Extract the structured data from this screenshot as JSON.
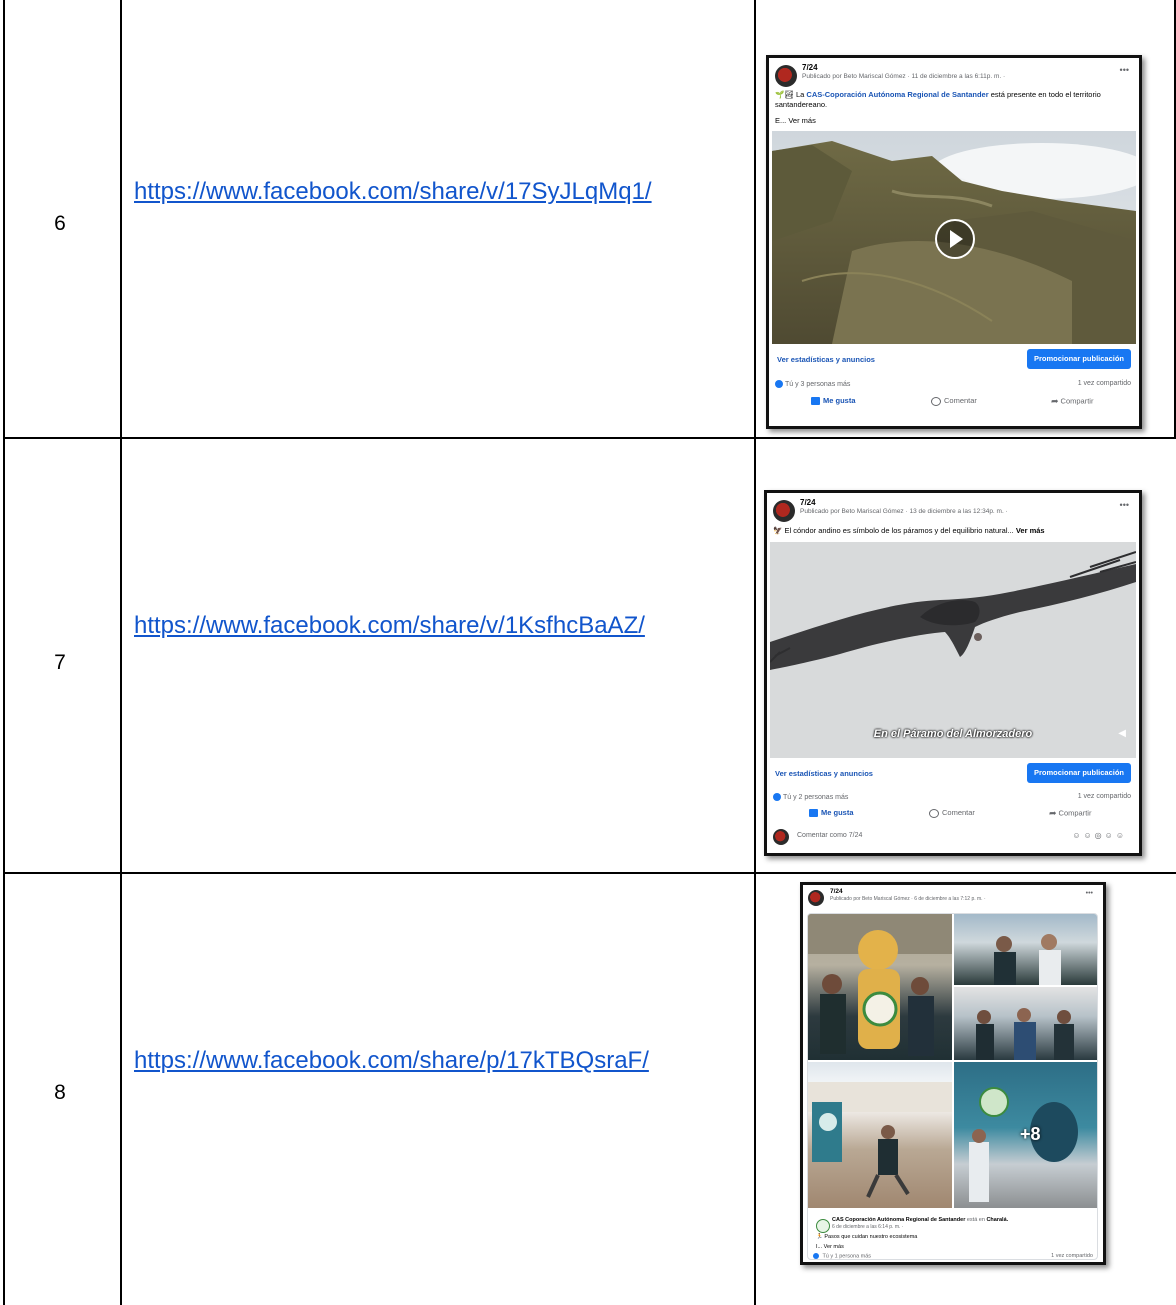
{
  "rows": [
    {
      "number": "6",
      "link": "https://www.facebook.com/share/v/17SyJLqMq1/",
      "post": {
        "page_name": "7/24",
        "meta": "Publicado por Beto Mariscal Gómez · 11 de diciembre a las 6:11p. m. ·",
        "text_prefix": "La",
        "text_link": "CAS-Coporación Autónoma Regional de Santander",
        "text_suffix": "está presente en todo el territorio santandereano.",
        "see_more": "E... Ver más",
        "stats_link": "Ver estadísticas y anuncios",
        "promote": "Promocionar publicación",
        "reactions": "Tú y 3 personas más",
        "shares": "1 vez compartido",
        "like": "Me gusta",
        "comment": "Comentar",
        "share": "Compartir"
      }
    },
    {
      "number": "7",
      "link": "https://www.facebook.com/share/v/1KsfhcBaAZ/",
      "post": {
        "page_name": "7/24",
        "meta": "Publicado por Beto Mariscal Gómez · 13 de diciembre a las 12:34p. m. ·",
        "text": "El cóndor andino es símbolo de los páramos y del equilibrio natural...",
        "see_more": "Ver más",
        "caption": "En el Páramo del Almorzadero",
        "stats_link": "Ver estadísticas y anuncios",
        "promote": "Promocionar publicación",
        "reactions": "Tú y 2 personas más",
        "shares": "1 vez compartido",
        "like": "Me gusta",
        "comment": "Comentar",
        "share": "Compartir",
        "comment_placeholder": "Comentar como 7/24"
      }
    },
    {
      "number": "8",
      "link": "https://www.facebook.com/share/p/17kTBQsraF/",
      "post": {
        "page_name": "7/24",
        "meta": "Publicado por Beto Mariscal Gómez · 6 de diciembre a las 7:12 p. m. ·",
        "more_photos": "+8",
        "shared_page": "CAS Coporación Autónoma Regional de Santander",
        "shared_location_prefix": "está en",
        "shared_location": "Charalá.",
        "shared_meta": "6 de diciembre a las 6:14 p. m. ·",
        "shared_text": "Pasos que cuidan nuestro ecosistema",
        "shared_see_more": "I... Ver más",
        "reactions": "Tú y 1 persona más",
        "shares": "1 vez compartido"
      }
    }
  ],
  "colors": {
    "link": "#1155cc",
    "facebook_blue": "#1877f2",
    "border": "#000000"
  }
}
